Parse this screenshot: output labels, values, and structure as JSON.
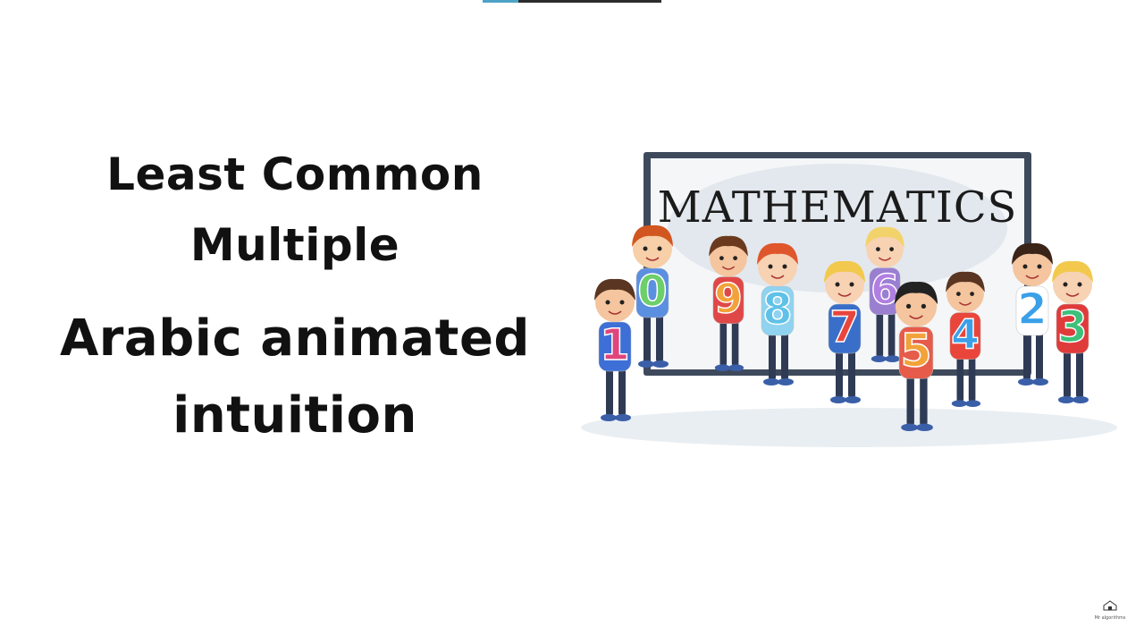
{
  "title": {
    "line1": "Least Common",
    "line2": "Multiple",
    "line3": "Arabic animated",
    "line4": "intuition"
  },
  "board": {
    "label": "MATHEMATICS"
  },
  "kids": [
    {
      "digit": "1",
      "shirt": "#3d6fd6",
      "hair": "#5a3521",
      "skin": "#f4c59e"
    },
    {
      "digit": "0",
      "shirt": "#5b8fe0",
      "hair": "#d2561f",
      "skin": "#f7cfa9"
    },
    {
      "digit": "9",
      "shirt": "#e04848",
      "hair": "#6b3a1e",
      "skin": "#f4c59e"
    },
    {
      "digit": "8",
      "shirt": "#8fd3f0",
      "hair": "#e0562c",
      "skin": "#f7d2b3"
    },
    {
      "digit": "7",
      "shirt": "#3a6fc9",
      "hair": "#f2c94c",
      "skin": "#f7d2b3"
    },
    {
      "digit": "6",
      "shirt": "#9a7fd1",
      "hair": "#f2d36b",
      "skin": "#f7d2b3"
    },
    {
      "digit": "5",
      "shirt": "#e65b4a",
      "hair": "#222222",
      "skin": "#f4c59e"
    },
    {
      "digit": "4",
      "shirt": "#e9453b",
      "hair": "#5a3521",
      "skin": "#f4c59e"
    },
    {
      "digit": "2",
      "shirt": "#ffffff",
      "hair": "#3a2418",
      "skin": "#f4c59e"
    },
    {
      "digit": "3",
      "shirt": "#e03b3b",
      "hair": "#f2c94c",
      "skin": "#f7d2b3"
    }
  ],
  "digit_colors": [
    "#e0457b",
    "#6ccf6a",
    "#f2a23a",
    "#5fc1e8",
    "#e8453c",
    "#b07fe0",
    "#f2a23a",
    "#3aa0e8",
    "#3aa0e8",
    "#3cc07a"
  ],
  "watermark": {
    "text": "Mr algorithms",
    "icon": "house-icon"
  }
}
